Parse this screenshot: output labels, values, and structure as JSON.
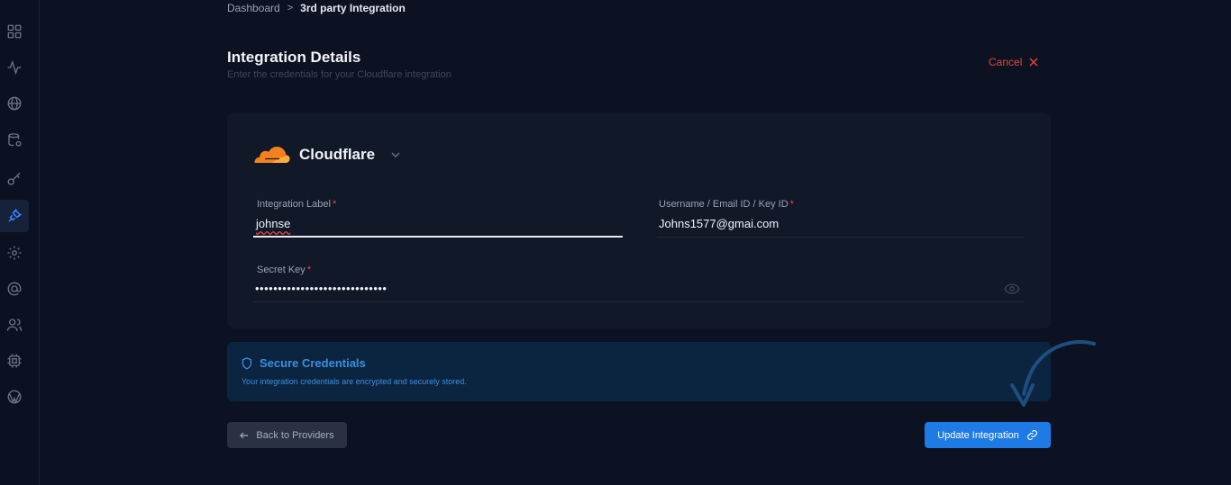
{
  "breadcrumb": {
    "parent": "Dashboard",
    "separator": ">",
    "current": "3rd party Integration"
  },
  "header": {
    "title": "Integration Details",
    "subtitle": "Enter the credentials for your Cloudflare integration",
    "cancel_label": "Cancel"
  },
  "provider": {
    "name": "Cloudflare",
    "logo_color": "#f48120"
  },
  "fields": {
    "label": {
      "label": "Integration Label",
      "required_mark": "*",
      "value": "johnse"
    },
    "username": {
      "label": "Username / Email ID / Key ID",
      "required_mark": "*",
      "value": "Johns1577@gmai.com"
    },
    "secret": {
      "label": "Secret Key",
      "required_mark": "*",
      "value": "•••••••••••••••••••••••••••••"
    }
  },
  "secure": {
    "title": "Secure Credentials",
    "description": "Your integration credentials are encrypted and securely stored."
  },
  "buttons": {
    "back": "Back to Providers",
    "update": "Update Integration"
  },
  "sidebar": {
    "icons": [
      "dashboard-icon",
      "activity-icon",
      "globe-icon",
      "database-icon",
      "key-icon",
      "plug-icon",
      "settings-icon",
      "at-sign-icon",
      "users-icon",
      "chip-icon",
      "wordpress-icon"
    ],
    "active_icon": "plug-icon"
  },
  "colors": {
    "accent": "#1e7be6",
    "danger": "#e0473a",
    "background": "#0c1222",
    "card": "#111827"
  }
}
